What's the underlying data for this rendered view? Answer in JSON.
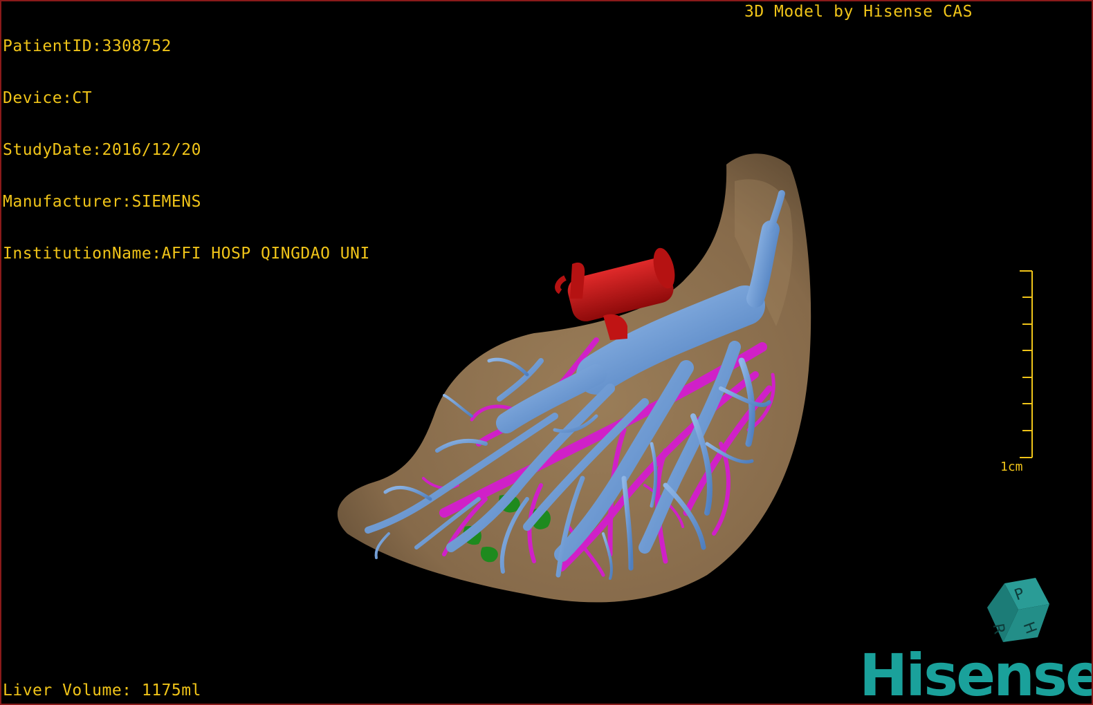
{
  "patient_info": {
    "patient_id": "PatientID:3308752",
    "device": "Device:CT",
    "study_date": "StudyDate:2016/12/20",
    "manufacturer": "Manufacturer:SIEMENS",
    "institution": "InstitutionName:AFFI HOSP QINGDAO UNI"
  },
  "credit": "3D Model by Hisense CAS",
  "liver_volume": "Liver Volume: 1175ml",
  "scale_bar": {
    "label": "1cm",
    "tick_count": 8
  },
  "orientation_cube": {
    "faces": [
      "P",
      "H",
      "R"
    ]
  },
  "logo_text": "Hisense",
  "colors": {
    "overlay_text": "#f0c419",
    "liver": "#8c7150",
    "portal_vein": "#6f9bd1",
    "hepatic_vein": "#d020c8",
    "artery": "#c21010",
    "lesion": "#1e8a1e",
    "brand": "#1aa19b"
  }
}
